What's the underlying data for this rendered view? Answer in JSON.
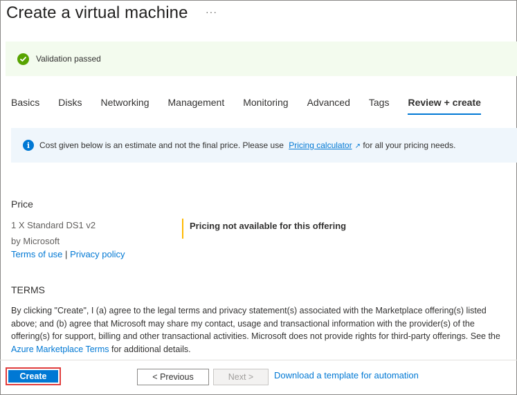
{
  "header": {
    "title": "Create a virtual machine",
    "more_label": "···"
  },
  "validation": {
    "text": "Validation passed",
    "status_color": "#57a300"
  },
  "tabs": [
    {
      "label": "Basics",
      "active": false
    },
    {
      "label": "Disks",
      "active": false
    },
    {
      "label": "Networking",
      "active": false
    },
    {
      "label": "Management",
      "active": false
    },
    {
      "label": "Monitoring",
      "active": false
    },
    {
      "label": "Advanced",
      "active": false
    },
    {
      "label": "Tags",
      "active": false
    },
    {
      "label": "Review + create",
      "active": true
    }
  ],
  "info_banner": {
    "icon": "info-icon",
    "text_before": "Cost given below is an estimate and not the final price. Please use",
    "link_text": "Pricing calculator",
    "text_after": "for all your pricing needs."
  },
  "price": {
    "heading": "Price",
    "offer_name": "1 X Standard DS1 v2",
    "publisher": "by Microsoft",
    "terms_link": "Terms of use",
    "separator": "|",
    "privacy_link": "Privacy policy",
    "pricing_note": "Pricing not available for this offering"
  },
  "terms": {
    "heading": "TERMS",
    "body_before": "By clicking \"Create\", I (a) agree to the legal terms and privacy statement(s) associated with the Marketplace offering(s) listed above; and (b) agree that Microsoft may share my contact, usage and transactional information with the provider(s) of the offering(s) for support, billing and other transactional activities. Microsoft does not provide rights for third-party offerings. See the",
    "link_text": "Azure Marketplace Terms",
    "body_after": "for additional details."
  },
  "footer": {
    "create_label": "Create",
    "previous_label": "< Previous",
    "next_label": "Next >",
    "download_link": "Download a template for automation"
  },
  "colors": {
    "accent": "#0078d4",
    "warning_bar": "#ffb900",
    "highlight_border": "#e03c3c"
  }
}
